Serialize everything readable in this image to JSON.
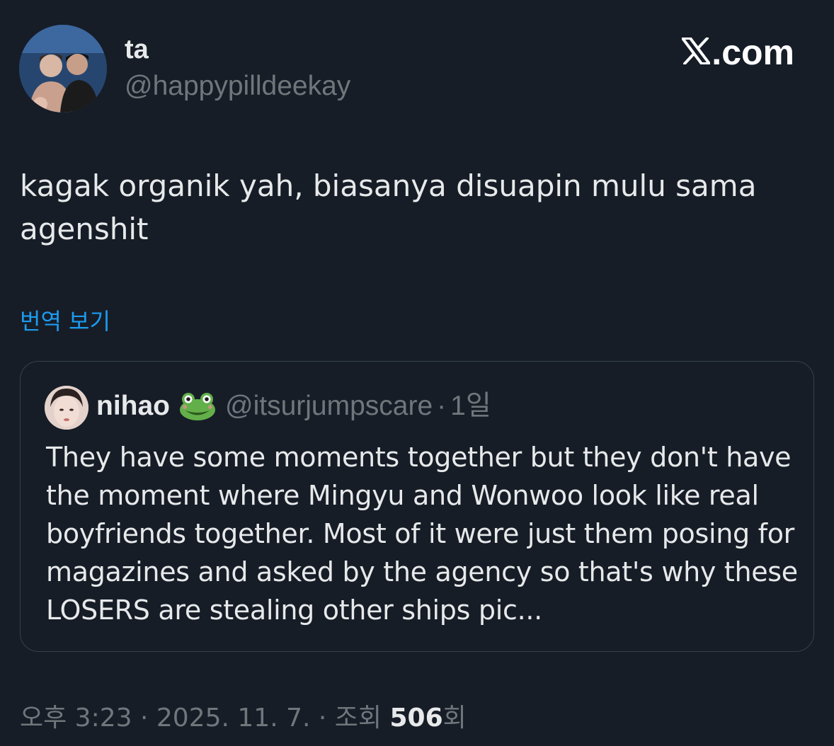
{
  "author": {
    "display_name": "ta",
    "handle": "@happypilldeekay",
    "avatar_icon": "profile-photo"
  },
  "brand": {
    "logo_icon": "x-logo",
    "site_text": ".com"
  },
  "tweet": {
    "text": "kagak organik yah, biasanya disuapin mulu sama agenshit",
    "translate_label": "번역 보기"
  },
  "quoted_tweet": {
    "display_name": "nihao",
    "name_emoji": "frog-face-icon",
    "handle": "@itsurjumpscare",
    "separator": "·",
    "time": "1일",
    "text": "They have some moments together but they don't have the moment where Mingyu and Wonwoo look like real boyfriends together. Most of it were just them posing for magazines and asked by the agency so that's why these LOSERS are stealing other ships pic..."
  },
  "meta": {
    "time": "오후 3:23",
    "date": "2025. 11. 7.",
    "separator": "·",
    "views_label": "조회",
    "views_count": "506",
    "views_suffix": "회"
  },
  "colors": {
    "background": "#161d27",
    "text": "#e7e9ea",
    "muted": "#71767b",
    "link": "#1d9bf0",
    "border": "#37404a"
  }
}
